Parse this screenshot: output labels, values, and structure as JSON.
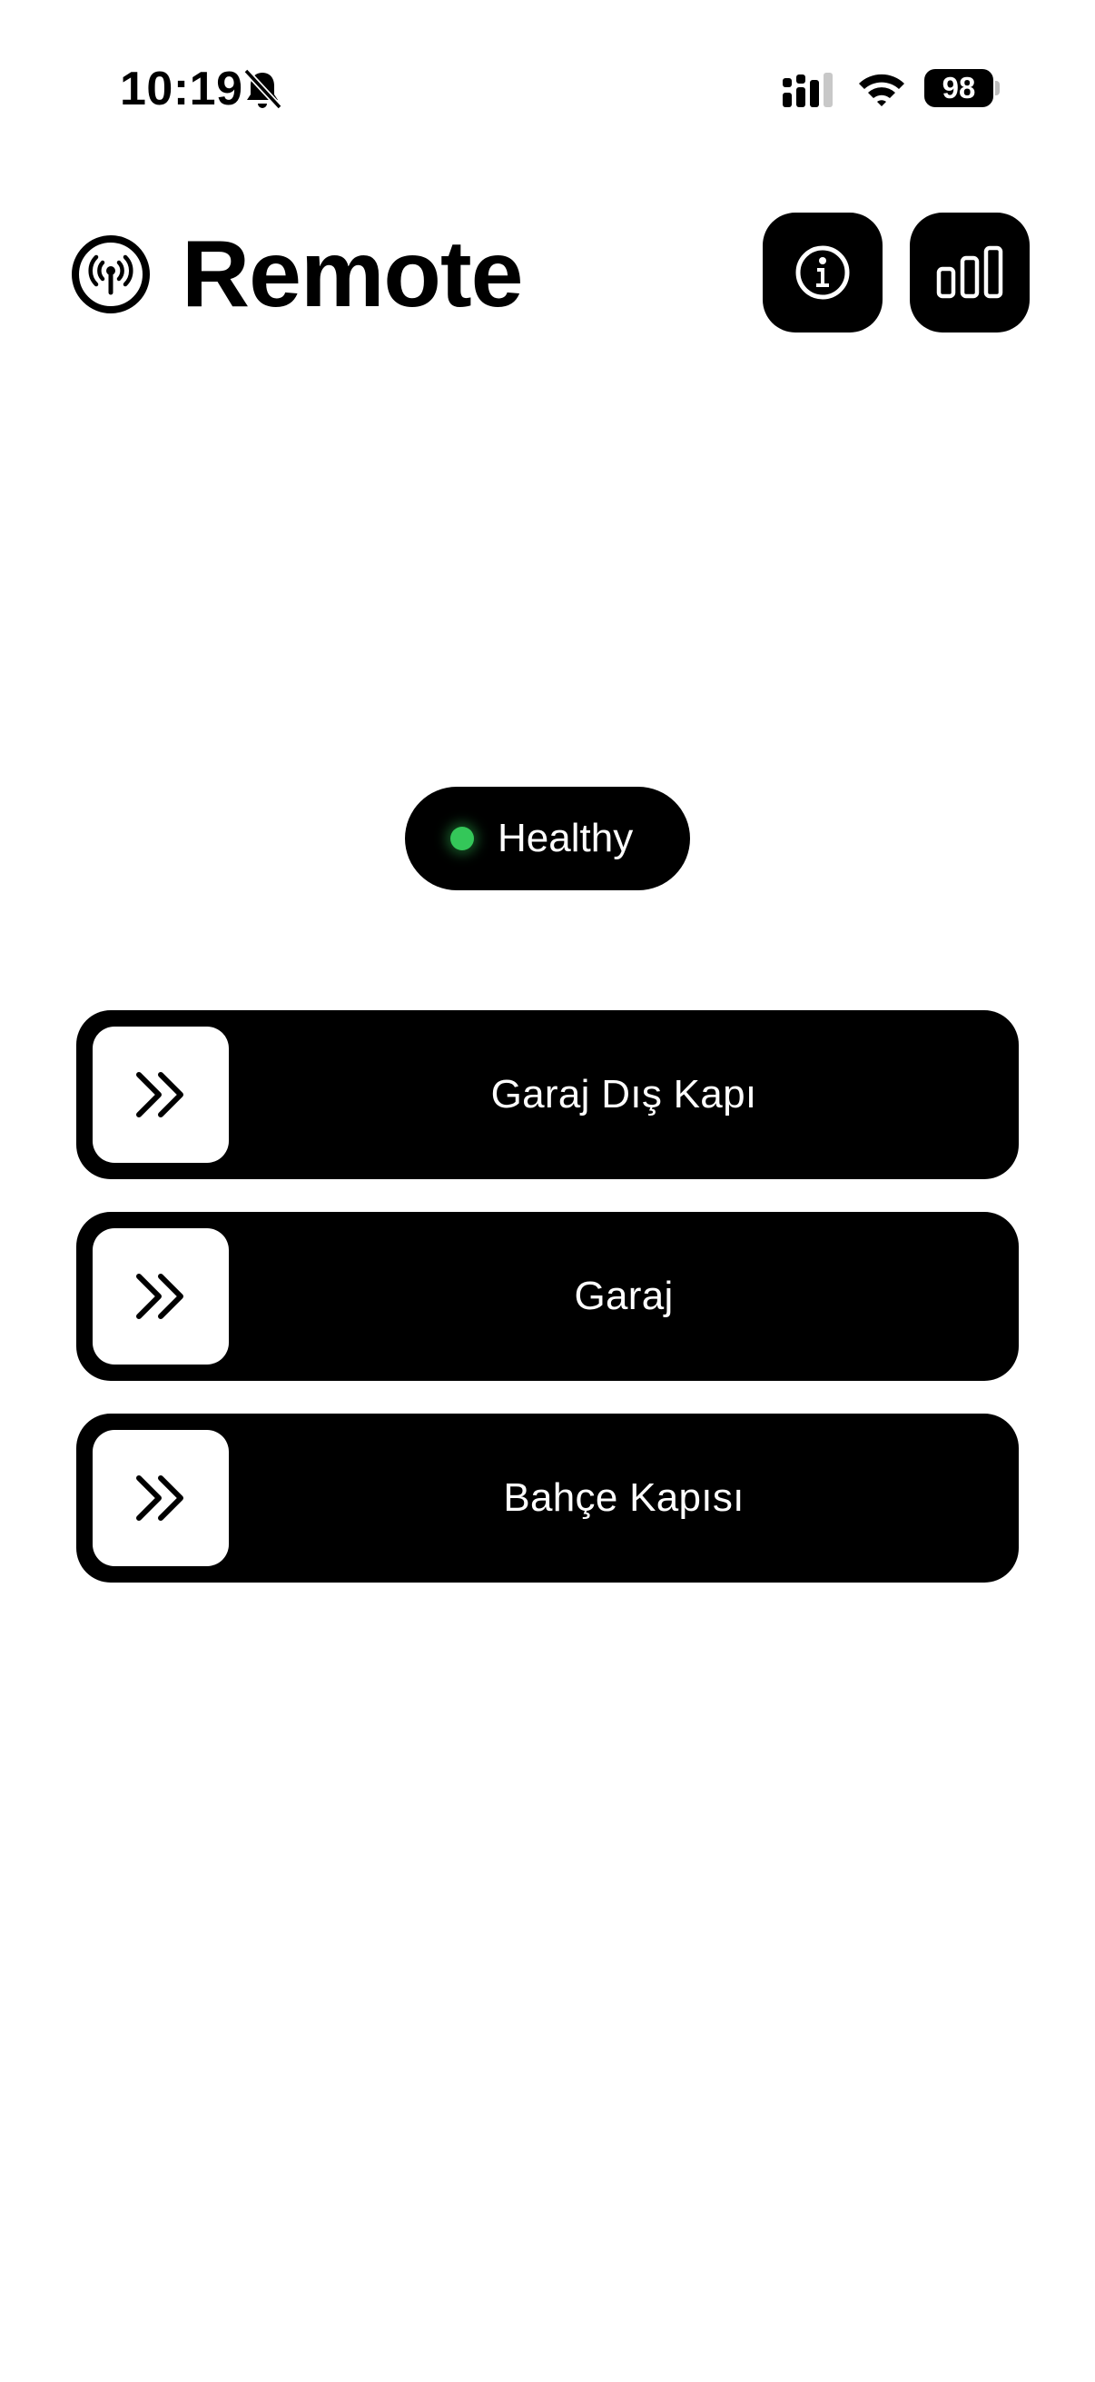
{
  "status_bar": {
    "time": "10:19",
    "battery": "98",
    "icons": [
      "bell-off-icon",
      "cell-signal-icon",
      "wifi-icon",
      "battery-icon"
    ]
  },
  "header": {
    "logo_icon": "broadcast-icon",
    "title": "Remote",
    "buttons": [
      {
        "name": "info-button",
        "icon": "info-icon"
      },
      {
        "name": "stats-button",
        "icon": "bar-chart-icon"
      }
    ]
  },
  "health": {
    "label": "Healthy",
    "color": "#34c759"
  },
  "remotes": [
    {
      "label": "Garaj Dış Kapı",
      "icon": "double-chevron-right-icon"
    },
    {
      "label": "Garaj",
      "icon": "double-chevron-right-icon"
    },
    {
      "label": "Bahçe Kapısı",
      "icon": "double-chevron-right-icon"
    }
  ],
  "colors": {
    "background": "#ffffff",
    "button": "#000000",
    "accent_ok": "#34c759"
  }
}
